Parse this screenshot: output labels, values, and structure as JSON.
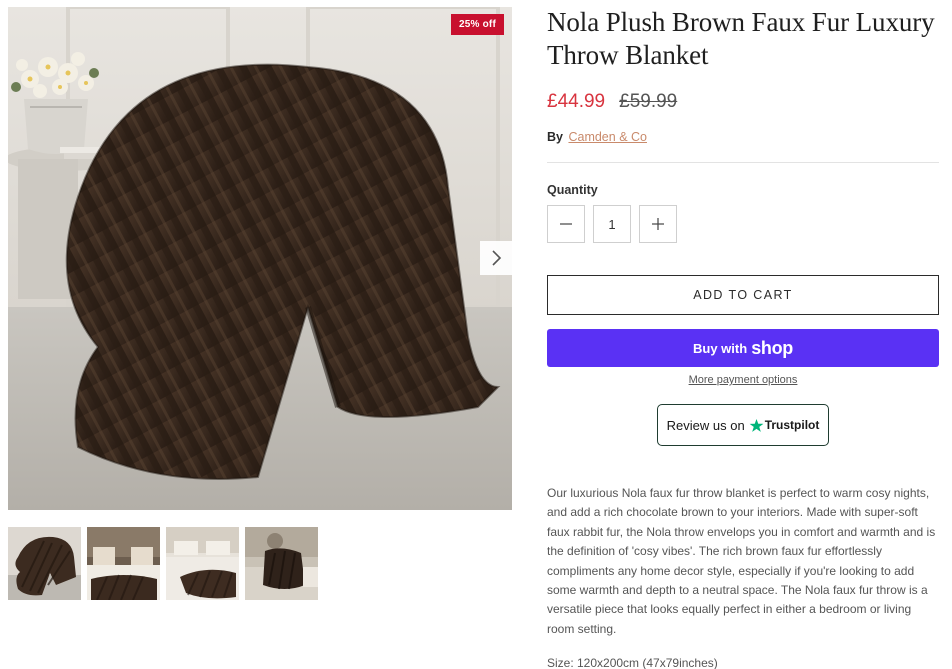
{
  "gallery": {
    "main_image_alt": "Brown faux fur throw blanket draped over armchair",
    "badge": "25% off",
    "next_icon": "chevron-right-icon",
    "thumbnails": [
      {
        "name": "thumb-chair"
      },
      {
        "name": "thumb-bedroom"
      },
      {
        "name": "thumb-bed-light"
      },
      {
        "name": "thumb-living-room"
      }
    ]
  },
  "product": {
    "title": "Nola Plush Brown Faux Fur Luxury Throw Blanket",
    "price": "£44.99",
    "compare_price": "£59.99",
    "vendor_prefix": "By",
    "vendor": "Camden & Co",
    "quantity_label": "Quantity",
    "quantity": "1",
    "minus_icon": "minus-icon",
    "plus_icon": "plus-icon",
    "add_to_cart": "ADD TO CART",
    "buy_with": "Buy with",
    "shop_word": "shop",
    "more_payment": "More payment options",
    "review_prefix": "Review us on",
    "trustpilot": "Trustpilot",
    "description": "Our luxurious Nola faux fur throw blanket is perfect to warm cosy nights, and add a rich chocolate brown to your interiors. Made with super-soft faux rabbit fur, the Nola throw envelops you in comfort and warmth and is the definition of 'cosy vibes'. The rich brown faux fur effortlessly compliments any home decor style, especially if you're looking to add some warmth and depth to a neutral space. The Nola faux fur throw is a versatile piece that looks equally perfect in either a bedroom or living room setting.",
    "size": "Size: 120x200cm (47x79inches)"
  },
  "colors": {
    "sale": "#d8343f",
    "badge": "#c8102e",
    "shop_purple": "#5a31f4",
    "vendor_link": "#c98a6b",
    "trustpilot_green": "#00b67a"
  }
}
